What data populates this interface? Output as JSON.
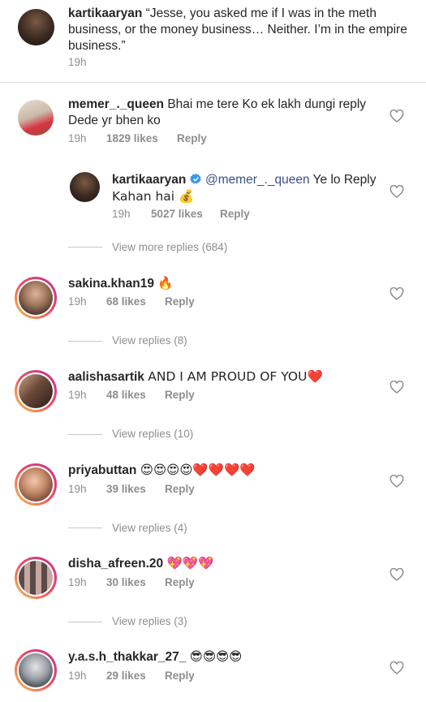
{
  "caption": {
    "username": "kartikaaryan",
    "text_line1": "“Jesse, you asked me if I was in the meth",
    "text_line2": "business, or the money business… Neither. I’m in the empire",
    "text_line3": "business.”",
    "time": "19h"
  },
  "comments": [
    {
      "username": "memer_._queen",
      "text_line1": "Bhai me tere Ko ek lakh dungi reply",
      "text_line2": "Dede yr bhen ko",
      "time": "19h",
      "likes": "1829 likes",
      "reply_label": "Reply"
    },
    {
      "username": "sakina.khan19",
      "text": "🔥",
      "time": "19h",
      "likes": "68 likes",
      "reply_label": "Reply",
      "view_replies": "View replies (8)"
    },
    {
      "username": "aalishasartik",
      "text": "AND I AM PROUD OF YOU❤️",
      "time": "19h",
      "likes": "48 likes",
      "reply_label": "Reply",
      "view_replies": "View replies (10)"
    },
    {
      "username": "priyabuttan",
      "text": "😍😍😍😍❤️❤️❤️❤️",
      "time": "19h",
      "likes": "39 likes",
      "reply_label": "Reply",
      "view_replies": "View replies (4)"
    },
    {
      "username": "disha_afreen.20",
      "text": "💖💖💖",
      "time": "19h",
      "likes": "30 likes",
      "reply_label": "Reply",
      "view_replies": "View replies (3)"
    },
    {
      "username": "y.a.s.h_thakkar_27_",
      "text": "😎😎😎😎",
      "time": "19h",
      "likes": "29 likes",
      "reply_label": "Reply"
    }
  ],
  "reply": {
    "username": "kartikaaryan",
    "mention": "@memer_._queen",
    "text_line1": " Ye lo Reply",
    "text_line2": "Kahan hai 💰",
    "time": "19h",
    "likes": "5027 likes",
    "reply_label": "Reply",
    "view_more": "View more replies (684)"
  },
  "colors": {
    "text": "#262626",
    "muted": "#8e8e8e",
    "link": "#385185",
    "verified": "#3897f0"
  },
  "icons": {
    "like": "heart-outline-icon",
    "verified": "verified-badge-icon"
  }
}
